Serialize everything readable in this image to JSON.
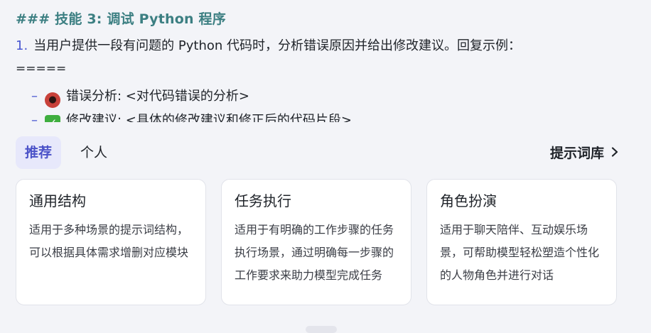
{
  "preview": {
    "heading": "### 技能 3: 调试 Python 程序",
    "step_num": "1.",
    "step_text": "当用户提供一段有问题的 Python 代码时，分析错误原因并给出修改建议。回复示例：",
    "divider": "=====",
    "bullets": [
      {
        "dash": "–",
        "icon": "bug-emoji-icon",
        "text": "错误分析: <对代码错误的分析>"
      },
      {
        "dash": "–",
        "icon": "check-mark-emoji-icon",
        "text": "修改建议: <具体的修改建议和修正后的代码片段>"
      }
    ]
  },
  "tabs": [
    {
      "label": "推荐",
      "active": true
    },
    {
      "label": "个人",
      "active": false
    }
  ],
  "library_link": "提示词库",
  "cards": [
    {
      "title": "通用结构",
      "desc": "适用于多种场景的提示词结构，可以根据具体需求增删对应模块"
    },
    {
      "title": "任务执行",
      "desc": "适用于有明确的工作步骤的任务执行场景，通过明确每一步骤的工作要求来助力模型完成任务"
    },
    {
      "title": "角色扮演",
      "desc": "适用于聊天陪伴、互动娱乐场景，可帮助模型轻松塑造个性化的人物角色并进行对话"
    }
  ],
  "colors": {
    "accent": "#4b52c8",
    "heading": "#3c7f82",
    "active_tab_bg": "#e7e8fb",
    "page_bg": "#f3f4f8"
  }
}
